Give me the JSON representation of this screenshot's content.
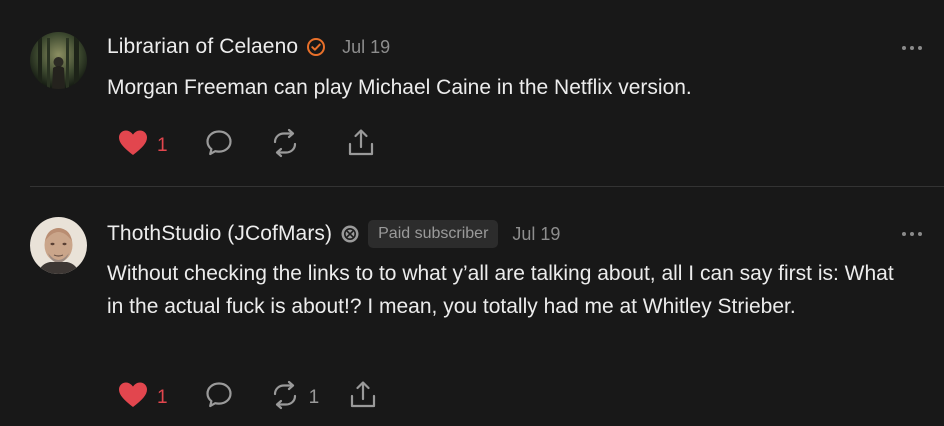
{
  "comments": [
    {
      "author": "Librarian of Celaeno",
      "date": "Jul 19",
      "text": "Morgan Freeman can play Michael Caine in the Netflix version.",
      "avatar": "forest-figure-avatar",
      "verified_icon": "verified-check-icon",
      "likes": "1",
      "restacks": ""
    },
    {
      "author": "ThothStudio (JCofMars)",
      "date": "Jul 19",
      "subscriber_badge": "Paid subscriber",
      "founding_icon": "founding-badge-icon",
      "text": "Without checking the links to to what y’all are talking about, all I can say first is: What in the actual fuck is about!? I mean, you totally had me at Whitley Strieber.",
      "avatar": "bald-man-avatar",
      "likes": "1",
      "restacks": "1"
    }
  ],
  "colors": {
    "background": "#181818",
    "heart": "#e2464e",
    "verified": "#e8702a",
    "muted": "#8d8d8d"
  }
}
